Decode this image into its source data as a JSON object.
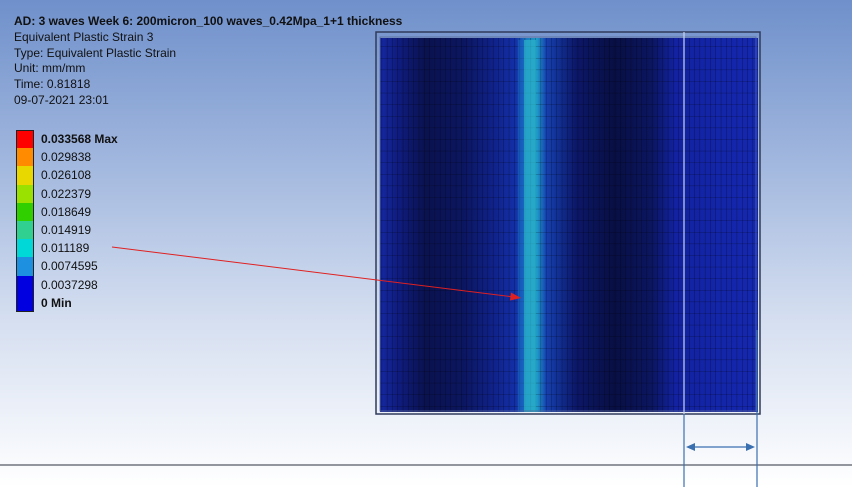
{
  "info": {
    "title": "AD: 3 waves Week 6: 200micron_100 waves_0.42Mpa_1+1 thickness",
    "result_name": "Equivalent Plastic Strain 3",
    "type": "Type: Equivalent Plastic Strain",
    "unit": "Unit: mm/mm",
    "time": "Time: 0.81818",
    "datetime": "09-07-2021 23:01"
  },
  "legend": {
    "max_label": "0.033568 Max",
    "min_label": "0 Min",
    "levels": [
      "0.029838",
      "0.026108",
      "0.022379",
      "0.018649",
      "0.014919",
      "0.011189",
      "0.0074595",
      "0.0037298"
    ],
    "colors": [
      "#ff0000",
      "#ff8c00",
      "#e8d800",
      "#9ae000",
      "#30d000",
      "#30d090",
      "#00d8d8",
      "#1e90e0",
      "#0000e0"
    ]
  },
  "colors": {
    "annotation_arrow": "#e02020",
    "dimension_line": "#3a6fb0",
    "axis_line": "#2a3040"
  }
}
